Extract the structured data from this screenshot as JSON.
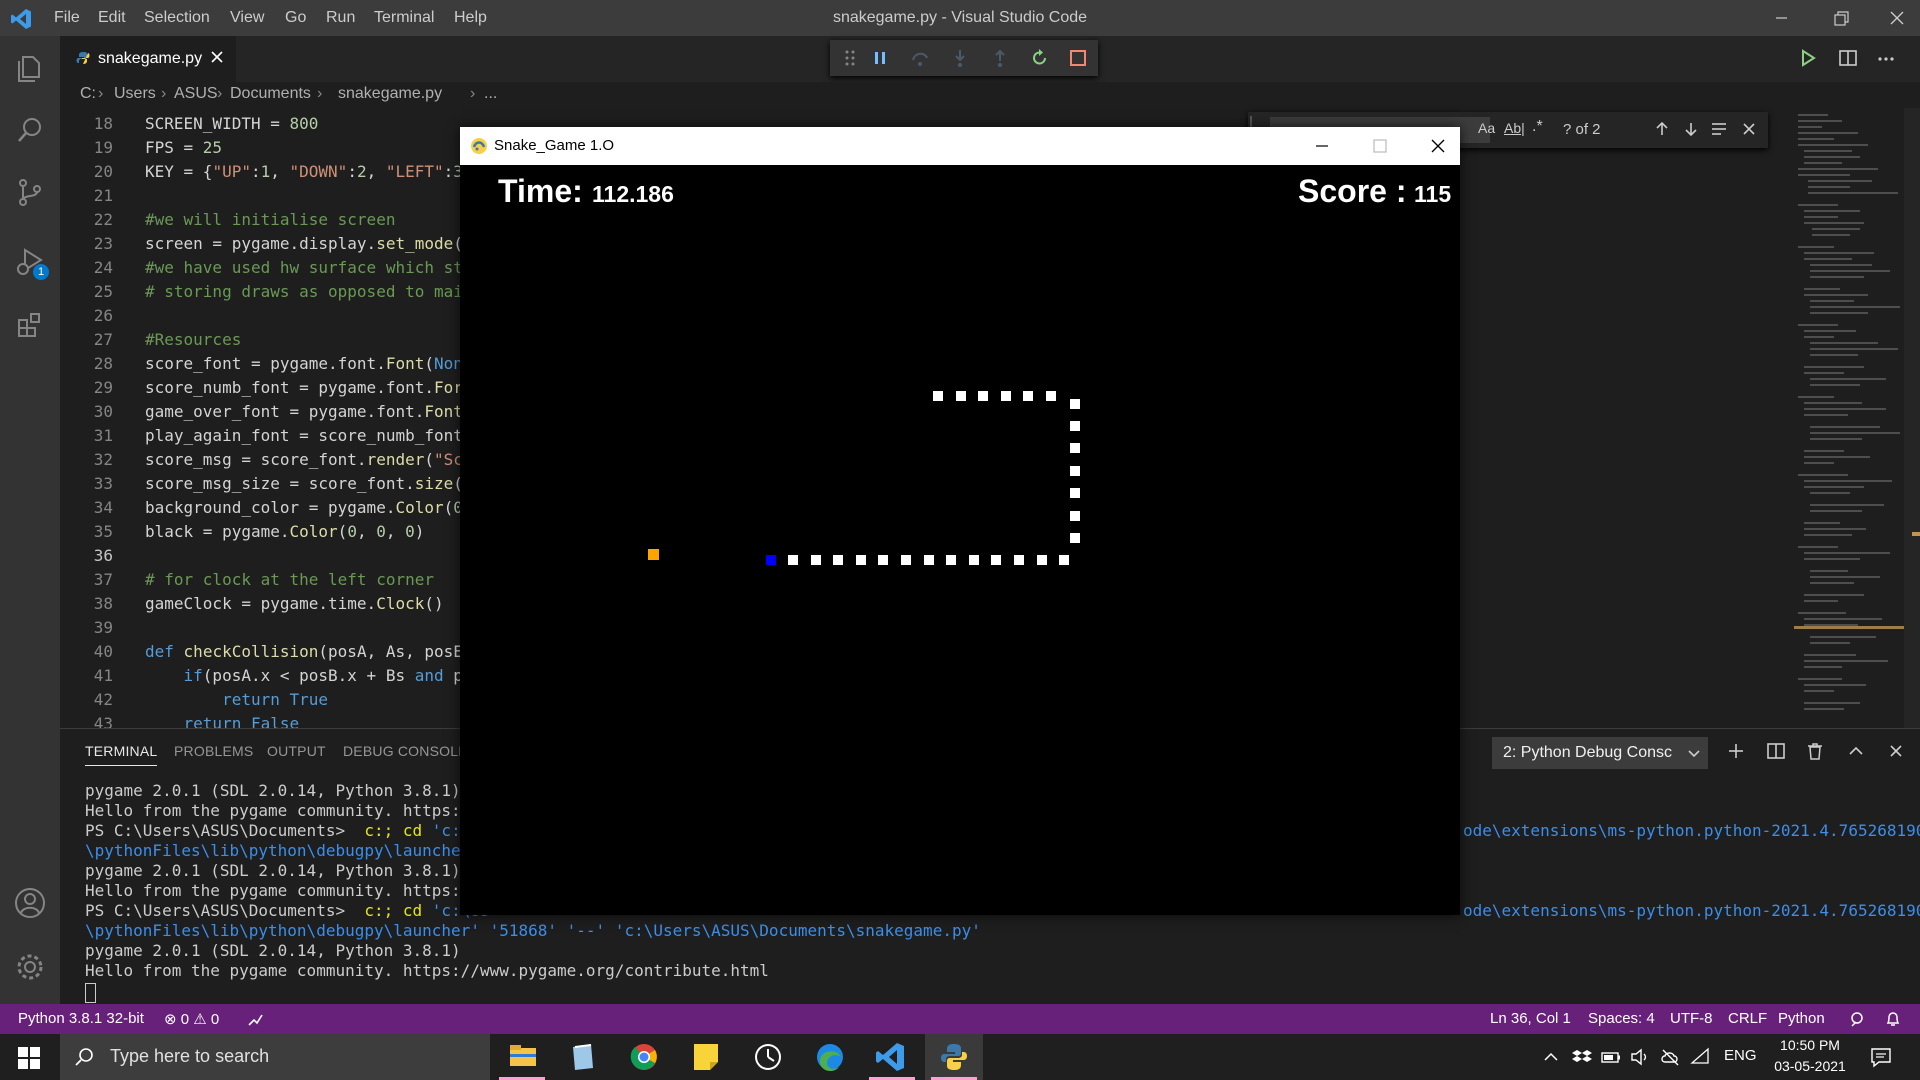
{
  "app": {
    "window_title": "snakegame.py - Visual Studio Code",
    "menu": [
      "File",
      "Edit",
      "Selection",
      "View",
      "Go",
      "Run",
      "Terminal",
      "Help"
    ]
  },
  "activity_bar": {
    "items": [
      "explorer-icon",
      "search-icon",
      "source-control-icon",
      "run-debug-icon",
      "extensions-icon"
    ],
    "debug_badge": "1",
    "bottom": [
      "account-icon",
      "settings-gear-icon"
    ]
  },
  "editor": {
    "tab_label": "snakegame.py",
    "breadcrumb": [
      "C:",
      "Users",
      "ASUS",
      "Documents",
      "snakegame.py",
      "..."
    ],
    "lines": [
      {
        "n": "18",
        "html": "SCREEN_WIDTH = <span class=\"num\">800</span>"
      },
      {
        "n": "19",
        "html": "FPS = <span class=\"num\">25</span>"
      },
      {
        "n": "20",
        "html": "KEY = {<span class=\"str\">\"UP\"</span>:<span class=\"num\">1</span>, <span class=\"str\">\"DOWN\"</span>:<span class=\"num\">2</span>, <span class=\"str\">\"LEFT\"</span>:<span class=\"num\">3</span>"
      },
      {
        "n": "21",
        "html": ""
      },
      {
        "n": "22",
        "html": "<span class=\"cm\">#we will initialise screen</span>"
      },
      {
        "n": "23",
        "html": "screen = pygame.display.<span class=\"fn\">set_mode</span>("
      },
      {
        "n": "24",
        "html": "<span class=\"cm\">#we have used hw surface which st</span>"
      },
      {
        "n": "25",
        "html": "<span class=\"cm\"># storing draws as opposed to mai</span>"
      },
      {
        "n": "26",
        "html": ""
      },
      {
        "n": "27",
        "html": "<span class=\"cm\">#Resources</span>"
      },
      {
        "n": "28",
        "html": "score_font = pygame.font.<span class=\"fn\">Font</span>(<span class=\"kw\">Non</span>"
      },
      {
        "n": "29",
        "html": "score_numb_font = pygame.font.<span class=\"fn\">For</span>"
      },
      {
        "n": "30",
        "html": "game_over_font = pygame.font.<span class=\"fn\">Font</span>"
      },
      {
        "n": "31",
        "html": "play_again_font = score_numb_font"
      },
      {
        "n": "32",
        "html": "score_msg = score_font.<span class=\"fn\">render</span>(<span class=\"str\">\"Sc</span>"
      },
      {
        "n": "33",
        "html": "score_msg_size = score_font.<span class=\"fn\">size</span>("
      },
      {
        "n": "34",
        "html": "background_color = pygame.<span class=\"fn\">Color</span>(<span class=\"num\">0</span>"
      },
      {
        "n": "35",
        "html": "black = pygame.<span class=\"fn\">Color</span>(<span class=\"num\">0</span>, <span class=\"num\">0</span>, <span class=\"num\">0</span>)"
      },
      {
        "n": "36",
        "html": ""
      },
      {
        "n": "37",
        "html": "<span class=\"cm\"># for clock at the left corner</span>"
      },
      {
        "n": "38",
        "html": "gameClock = pygame.time.<span class=\"fn\">Clock</span>()"
      },
      {
        "n": "39",
        "html": ""
      },
      {
        "n": "40",
        "html": "<span class=\"kw\">def</span> <span class=\"fn\">checkCollision</span>(posA, As, posE"
      },
      {
        "n": "41",
        "html": "    <span class=\"kw\">if</span>(posA.x &lt; posB.x + Bs <span class=\"kw\">and</span> p"
      },
      {
        "n": "42",
        "html": "        <span class=\"kw\">return</span> <span class=\"kw\">True</span>"
      },
      {
        "n": "43",
        "html": "    <span class=\"kw\">return</span> <span class=\"kw\">False</span>"
      }
    ]
  },
  "find_widget": {
    "match_case": "Aa",
    "whole_word": "Ab|",
    "regex": ".*",
    "result": "? of 2"
  },
  "panel": {
    "tabs": [
      "TERMINAL",
      "PROBLEMS",
      "OUTPUT",
      "DEBUG CONSOLE"
    ],
    "terminal_select": "2: Python Debug Consc",
    "lines": [
      {
        "text": "pygame 2.0.1 (SDL 2.0.14, Python 3.8.1)",
        "cls": ""
      },
      {
        "text": "Hello from the pygame community. https://w",
        "cls": ""
      },
      {
        "text": "PS C:\\Users\\ASUS\\Documents>  c:; cd 'c:\\Us",
        "cls": "ps"
      },
      {
        "text": "\\pythonFiles\\lib\\python\\debugpy\\launcher'",
        "cls": "cy"
      },
      {
        "text": "pygame 2.0.1 (SDL 2.0.14, Python 3.8.1)",
        "cls": ""
      },
      {
        "text": "Hello from the pygame community. https://w",
        "cls": ""
      },
      {
        "text": "PS C:\\Users\\ASUS\\Documents>  c:; cd 'c:\\Us",
        "cls": "ps"
      },
      {
        "text": "\\pythonFiles\\lib\\python\\debugpy\\launcher' '51868' '--' 'c:\\Users\\ASUS\\Documents\\snakegame.py'",
        "cls": "cy"
      },
      {
        "text": "pygame 2.0.1 (SDL 2.0.14, Python 3.8.1)",
        "cls": ""
      },
      {
        "text": "Hello from the pygame community. https://www.pygame.org/contribute.html",
        "cls": ""
      }
    ],
    "right_fragments": [
      "ode\\extensions\\ms-python.python-2021.4.765268190",
      "ode\\extensions\\ms-python.python-2021.4.765268190"
    ]
  },
  "statusbar": {
    "interpreter": "Python 3.8.1 32-bit",
    "errors": "0",
    "warnings": "0",
    "position": "Ln 36, Col 1",
    "spaces": "Spaces: 4",
    "encoding": "UTF-8",
    "eol": "CRLF",
    "language": "Python"
  },
  "taskbar": {
    "search_placeholder": "Type here to search",
    "apps": [
      "file-explorer-icon",
      "notepad-icon",
      "chrome-icon",
      "sticky-notes-icon",
      "clock-icon",
      "edge-icon",
      "vscode-icon",
      "python-icon"
    ],
    "language": "ENG",
    "time": "10:50 PM",
    "date": "03-05-2021"
  },
  "game": {
    "window_title": "Snake_Game 1.O",
    "time_label": "Time:",
    "time_value": "112.186",
    "score_label": "Score :",
    "score_value": "115"
  },
  "colors": {
    "statusbar": "#68217a",
    "snake_body": "#ffffff",
    "snake_head": "#0000ff",
    "food": "#ffa500"
  }
}
